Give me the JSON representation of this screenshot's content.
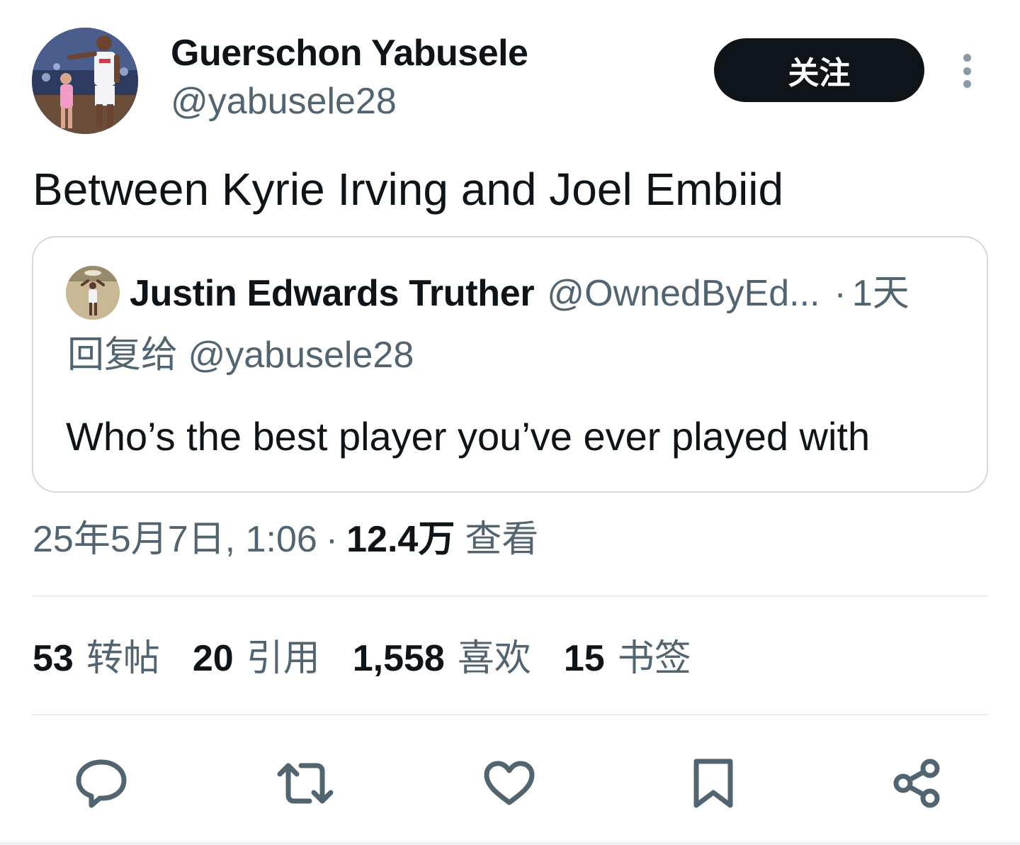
{
  "author": {
    "display_name": "Guerschon Yabusele",
    "handle": "@yabusele28",
    "avatar": "profile-photo-basketball-player"
  },
  "follow_label": "关注",
  "more_icon": "more-vertical-icon",
  "tweet": {
    "text": "Between Kyrie Irving and Joel Embiid"
  },
  "quote": {
    "display_name": "Justin Edwards Truther",
    "handle": "@OwnedByEd...",
    "dot": "·",
    "time": "1天",
    "reply_prefix": "回复给",
    "reply_to": "@yabusele28",
    "text": "Who’s the best player you’ve ever played with"
  },
  "meta": {
    "date": "25年5月7日, 1:06",
    "dot": "·",
    "views_count": "12.4万",
    "views_label": "查看"
  },
  "stats": [
    {
      "num": "53",
      "label": "转帖"
    },
    {
      "num": "20",
      "label": "引用"
    },
    {
      "num": "1,558",
      "label": "喜欢"
    },
    {
      "num": "15",
      "label": "书签"
    }
  ],
  "actions": [
    "reply-icon",
    "repost-icon",
    "like-icon",
    "bookmark-icon",
    "share-icon"
  ],
  "colors": {
    "text_primary": "#0f1419",
    "text_secondary": "#536471",
    "border": "#cfd9de",
    "icon": "#536471"
  }
}
